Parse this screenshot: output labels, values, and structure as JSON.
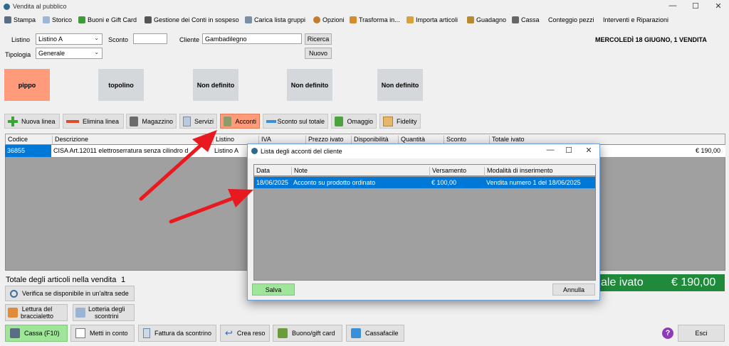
{
  "window": {
    "title": "Vendita al pubblico"
  },
  "menu": [
    "Stampa",
    "Storico",
    "Buoni e Gift Card",
    "Gestione dei Conti in sospeso",
    "Carica lista gruppi",
    "Opzioni",
    "Trasforma in...",
    "Importa articoli",
    "Guadagno",
    "Cassa",
    "Conteggio pezzi",
    "Interventi e Riparazioni"
  ],
  "form": {
    "listino_label": "Listino",
    "listino_value": "Listino A",
    "sconto_label": "Sconto",
    "sconto_value": "",
    "cliente_label": "Cliente",
    "cliente_value": "Gambadilegno",
    "tipologia_label": "Tipologia",
    "tipologia_value": "Generale",
    "ricerca": "Ricerca",
    "nuovo": "Nuovo"
  },
  "date_header": "MERCOLEDÌ 18 GIUGNO, 1 VENDITA",
  "tiles": [
    "pippo",
    "topolino",
    "Non definito",
    "Non definito",
    "Non definito"
  ],
  "toolbar": [
    "Nuova linea",
    "Elimina linea",
    "Magazzino",
    "Servizi",
    "Acconti",
    "Sconto sul totale",
    "Omaggio",
    "Fidelity"
  ],
  "grid": {
    "headers": [
      "Codice",
      "Descrizione",
      "Listino",
      "IVA",
      "Prezzo ivato",
      "Disponibilità",
      "Quantità",
      "Sconto",
      "Totale ivato"
    ],
    "row": {
      "codice": "36855",
      "descrizione": "CISA Art.12011 elettroserratura senza cilindro d",
      "listino": "Listino A",
      "totale": "€ 190,00"
    }
  },
  "summary": {
    "label": "Totale degli articoli nella vendita",
    "count": "1",
    "total_label": "ale ivato",
    "total_value": "€ 190,00"
  },
  "bottom_left": {
    "verifica": "Verifica se disponibile in un'altra sede",
    "bracc_1": "Lettura del",
    "bracc_2": "braccialetto",
    "lott_1": "Lotteria degli",
    "lott_2": "scontrini"
  },
  "bottom_bar": [
    "Cassa (F10)",
    "Metti in conto",
    "Fattura da scontrino",
    "Crea reso",
    "Buono/gift card",
    "Cassafacile"
  ],
  "esci": "Esci",
  "dialog": {
    "title": "Lista degli acconti del cliente",
    "headers": [
      "Data",
      "Note",
      "Versamento",
      "Modalità di inserimento"
    ],
    "row": {
      "data": "18/06/2025",
      "note": "Acconto su prodotto ordinato",
      "versamento": "€ 100,00",
      "modalita": "Vendita numero 1 del 18/06/2025"
    },
    "salva": "Salva",
    "annulla": "Annulla"
  },
  "colors": {
    "accent_orange": "#ff9b7a",
    "selection": "#0078d7",
    "total_green": "#1f8a3a",
    "arrow": "#e8191f"
  }
}
